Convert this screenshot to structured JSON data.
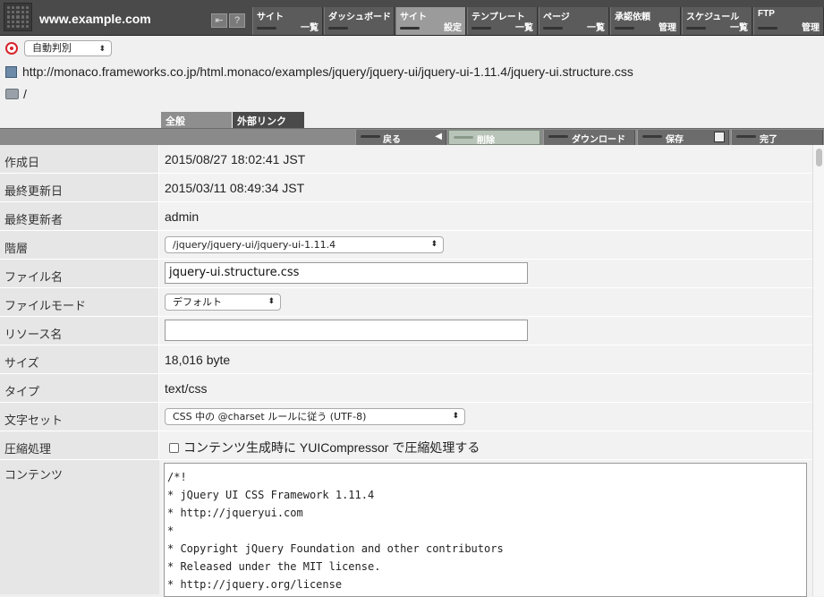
{
  "topbar": {
    "site_title": "www.example.com",
    "icons": [
      "logout-icon",
      "help-icon"
    ],
    "help_glyph": "?",
    "nav": [
      {
        "line1": "サイト",
        "line2": "一覧",
        "active": false
      },
      {
        "line1": "ダッシュボード",
        "line2": "",
        "active": false
      },
      {
        "line1": "サイト",
        "line2": "設定",
        "active": true
      },
      {
        "line1": "テンプレート",
        "line2": "一覧",
        "active": false
      },
      {
        "line1": "ページ",
        "line2": "一覧",
        "active": false
      },
      {
        "line1": "承認依頼",
        "line2": "管理",
        "active": false
      },
      {
        "line1": "スケジュール",
        "line2": "一覧",
        "active": false
      },
      {
        "line1": "FTP",
        "line2": "管理",
        "active": false
      }
    ]
  },
  "header": {
    "language_select": "自動判別",
    "url": "http://monaco.frameworks.co.jp/html.monaco/examples/jquery/jquery-ui/jquery-ui-1.11.4/jquery-ui.structure.css",
    "path": "/"
  },
  "tabs": {
    "general": "全般",
    "external_links": "外部リンク"
  },
  "actions": {
    "back": "戻る",
    "back_glyph": "◀",
    "delete": "削除",
    "download": "ダウンロード",
    "save": "保存",
    "done": "完了"
  },
  "form": {
    "created_label": "作成日",
    "created_value": "2015/08/27 18:02:41 JST",
    "modified_label": "最終更新日",
    "modified_value": "2015/03/11 08:49:34 JST",
    "modifier_label": "最終更新者",
    "modifier_value": "admin",
    "hierarchy_label": "階層",
    "hierarchy_value": "/jquery/jquery-ui/jquery-ui-1.11.4",
    "filename_label": "ファイル名",
    "filename_value": "jquery-ui.structure.css",
    "filemode_label": "ファイルモード",
    "filemode_value": "デフォルト",
    "resource_label": "リソース名",
    "resource_value": "",
    "size_label": "サイズ",
    "size_value": "18,016 byte",
    "type_label": "タイプ",
    "type_value": "text/css",
    "charset_label": "文字セット",
    "charset_value": "CSS 中の @charset ルールに従う (UTF-8)",
    "compress_label": "圧縮処理",
    "compress_text": "コンテンツ生成時に YUICompressor で圧縮処理する",
    "compress_checked": false,
    "content_label": "コンテンツ",
    "content_lines": [
      "/*!",
      " * jQuery UI CSS Framework 1.11.4",
      " * http://jqueryui.com",
      " *",
      " * Copyright jQuery Foundation and other contributors",
      " * Released under the MIT license.",
      " * http://jquery.org/license",
      " *"
    ]
  },
  "colors": {
    "topbar": "#4a4a4a",
    "active_tab": "#9b9b9b",
    "target_red": "#d8232a"
  }
}
